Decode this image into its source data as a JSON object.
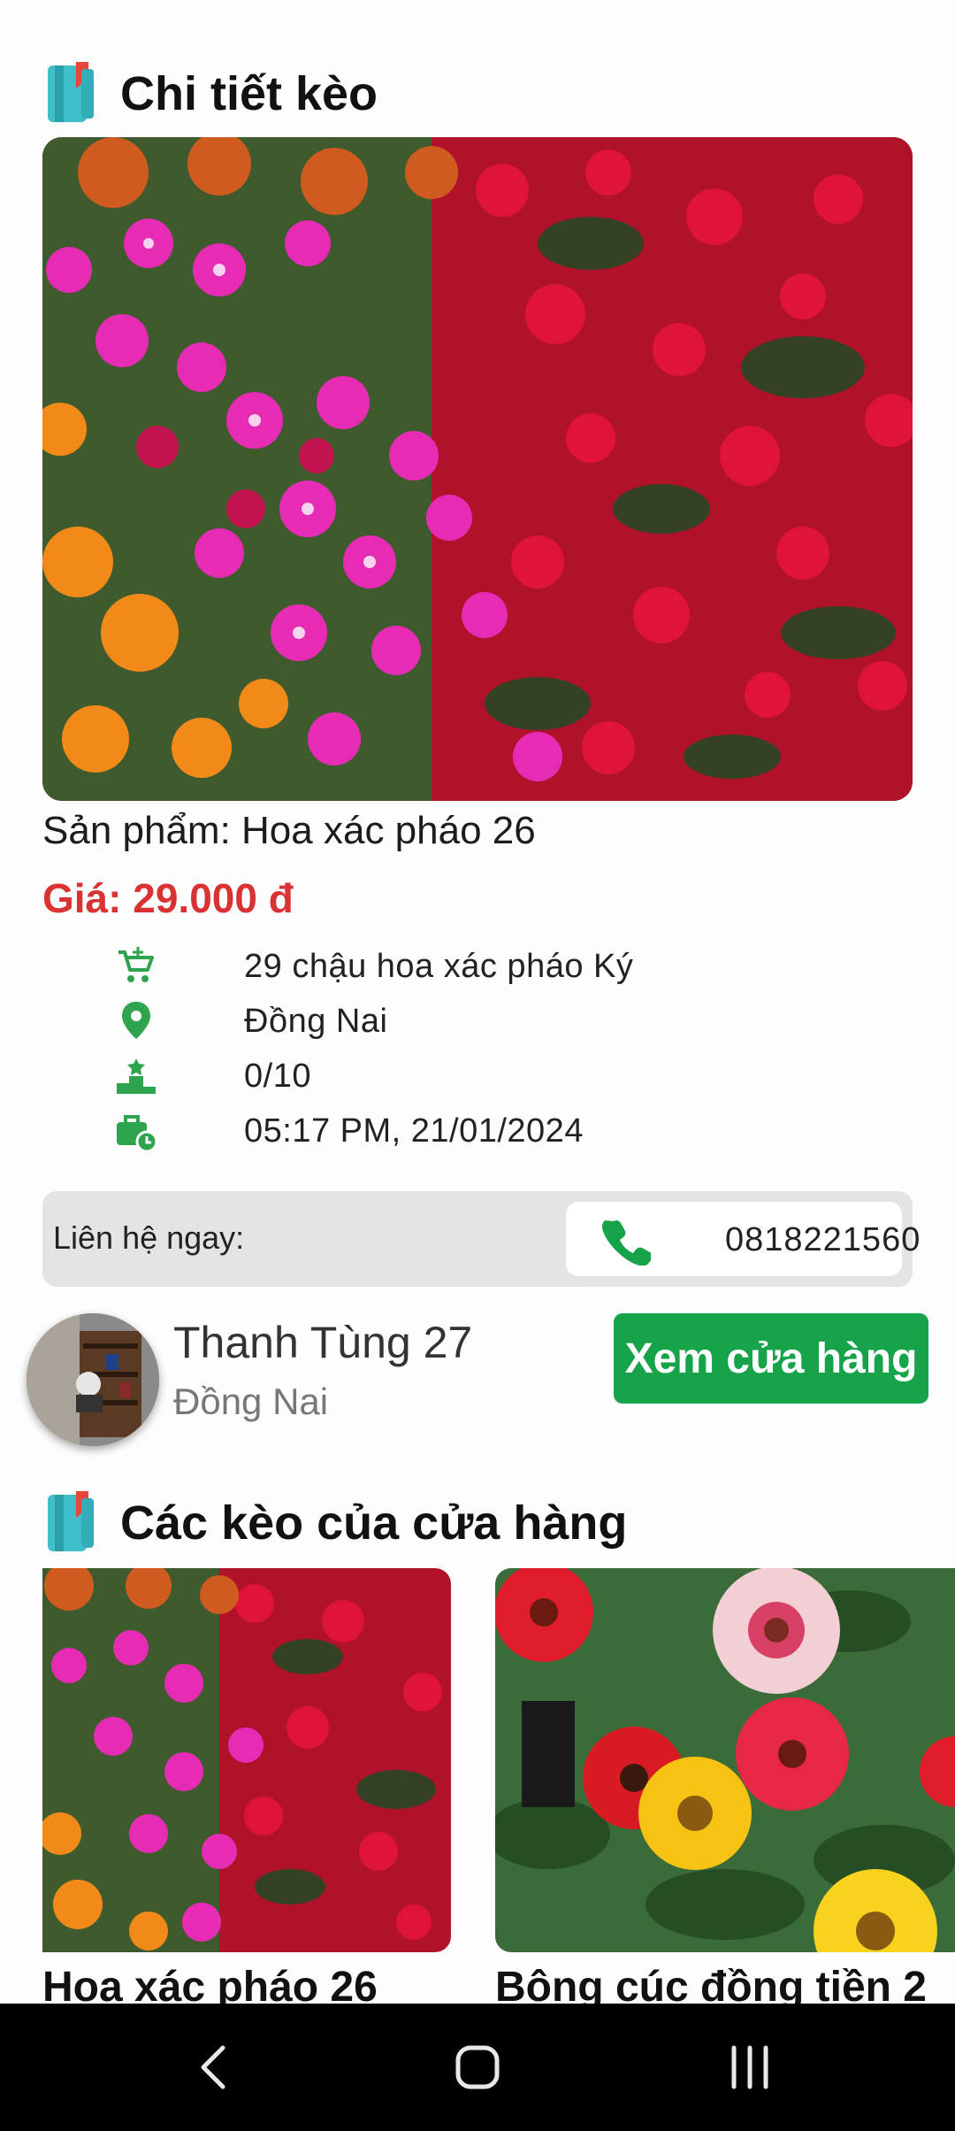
{
  "detail": {
    "title": "Chi tiết kèo",
    "product_name": "Sản phẩm: Hoa xác pháo 26",
    "price": "Giá: 29.000 đ",
    "info": {
      "description": "29 chậu hoa xác pháo Ký",
      "location": "Đồng Nai",
      "rank": "0/10",
      "time": "05:17 PM, 21/01/2024"
    },
    "contact_label": "Liên hệ ngay:",
    "phone": "0818221560"
  },
  "shop": {
    "name": "Thanh Tùng 27",
    "location": "Đồng Nai",
    "view_store_label": "Xem cửa hàng"
  },
  "store_deals": {
    "title": "Các kèo của cửa hàng",
    "cards": [
      {
        "title": "Hoa xác pháo 26"
      },
      {
        "title": "Bông cúc đồng tiền 2"
      }
    ]
  },
  "icons": {
    "section": "notebook-icon",
    "cart": "cart-icon",
    "location": "location-pin-icon",
    "rank": "podium-icon",
    "time": "briefcase-clock-icon",
    "phone": "phone-icon"
  },
  "colors": {
    "accent_green": "#16a34a",
    "price_red": "#d93232",
    "icon_green": "#2ea44f"
  }
}
